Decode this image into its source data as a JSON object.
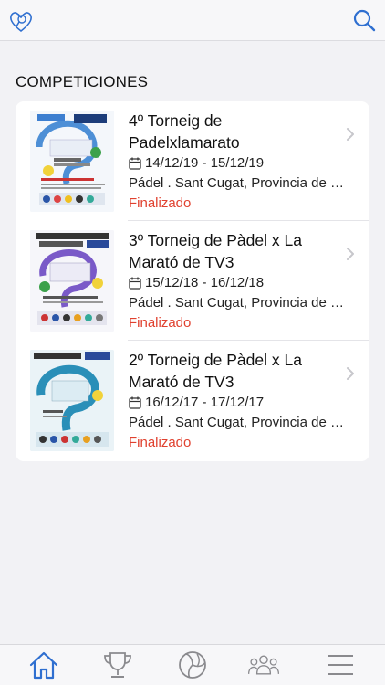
{
  "header": {
    "logo_icon": "heart-paddle-logo-icon",
    "search_icon": "search-icon"
  },
  "section": {
    "title": "COMPETICIONES"
  },
  "competitions": [
    {
      "title_line1": "4º Torneig de",
      "title_line2": "Padelxlamarato",
      "dates": "14/12/19 - 15/12/19",
      "location": "Pádel . Sant Cugat, Provincia de Barcelona",
      "status": "Finalizado"
    },
    {
      "title_line1": "3º Torneig de Pàdel x La",
      "title_line2": "Marató de TV3",
      "dates": "15/12/18 - 16/12/18",
      "location": "Pádel . Sant Cugat, Provincia de Barcelona",
      "status": "Finalizado"
    },
    {
      "title_line1": "2º Torneig de Pàdel x La",
      "title_line2": "Marató de TV3",
      "dates": "16/12/17 - 17/12/17",
      "location": "Pádel . Sant Cugat, Provincia de Barcelona",
      "status": "Finalizado"
    }
  ],
  "tabbar": {
    "items": [
      "home-icon",
      "trophy-icon",
      "volleyball-icon",
      "group-icon",
      "menu-icon"
    ],
    "active": "home-icon"
  },
  "colors": {
    "accent": "#2f6fd0",
    "status": "#e0412f",
    "background": "#f2f2f5"
  }
}
